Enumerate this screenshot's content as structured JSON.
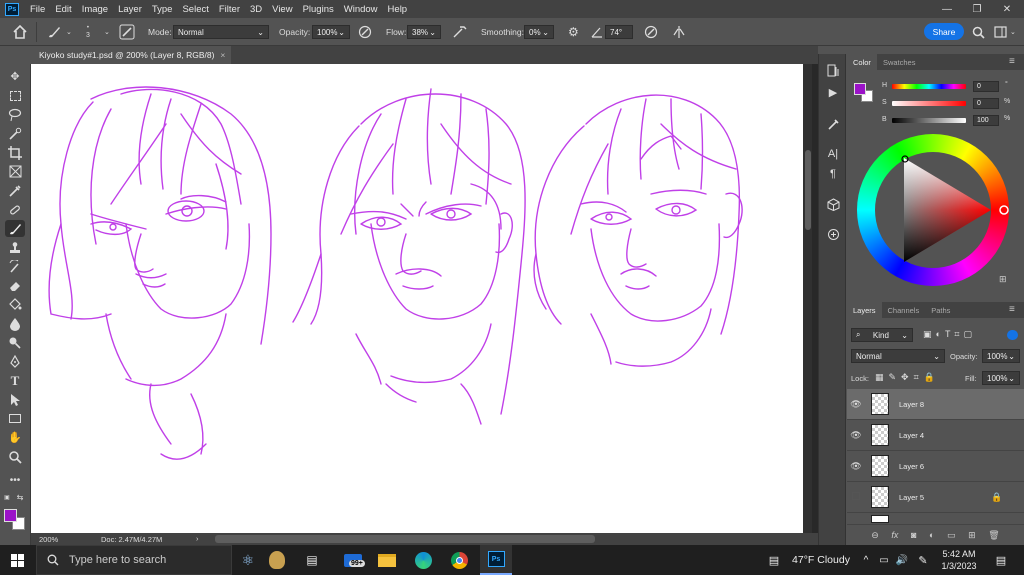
{
  "app": {
    "logo": "Ps"
  },
  "menu": [
    "File",
    "Edit",
    "Image",
    "Layer",
    "Type",
    "Select",
    "Filter",
    "3D",
    "View",
    "Plugins",
    "Window",
    "Help"
  ],
  "window_controls": {
    "minimize": "—",
    "restore": "❐",
    "close": "✕"
  },
  "options": {
    "brush_size": "3",
    "mode_label": "Mode:",
    "mode_value": "Normal",
    "opacity_label": "Opacity:",
    "opacity_value": "100%",
    "flow_label": "Flow:",
    "flow_value": "38%",
    "smoothing_label": "Smoothing:",
    "smoothing_value": "0%",
    "angle_value": "74°",
    "share_label": "Share"
  },
  "document": {
    "tab_title": "Kiyoko study#1.psd @ 200% (Layer 8, RGB/8)",
    "tab_close": "×",
    "zoom": "200%",
    "doc_size": "Doc: 2.47M/4.27M"
  },
  "color_panel": {
    "tabs": [
      "Color",
      "Swatches"
    ],
    "h_label": "H",
    "h_value": "0",
    "h_unit": "°",
    "s_label": "S",
    "s_value": "0",
    "s_unit": "%",
    "b_label": "B",
    "b_value": "100",
    "b_unit": "%",
    "foreground": "#9b12c8",
    "background": "#ffffff"
  },
  "layers_panel": {
    "tabs": [
      "Layers",
      "Channels",
      "Paths"
    ],
    "filter_label": "Kind",
    "blend_mode": "Normal",
    "opacity_label": "Opacity:",
    "opacity_value": "100%",
    "lock_label": "Lock:",
    "fill_label": "Fill:",
    "fill_value": "100%",
    "layers": [
      {
        "name": "Layer 8",
        "visible": true,
        "selected": true
      },
      {
        "name": "Layer 4",
        "visible": true,
        "selected": false
      },
      {
        "name": "Layer 6",
        "visible": true,
        "selected": false
      },
      {
        "name": "Layer 5",
        "visible": false,
        "selected": false,
        "locked": true
      }
    ]
  },
  "taskbar": {
    "search_placeholder": "Type here to search",
    "mail_badge": "99+",
    "weather": "47°F  Cloudy",
    "time": "5:42 AM",
    "date": "1/3/2023"
  },
  "colors": {
    "accent": "#1473e6",
    "sketch": "#c040e8"
  }
}
